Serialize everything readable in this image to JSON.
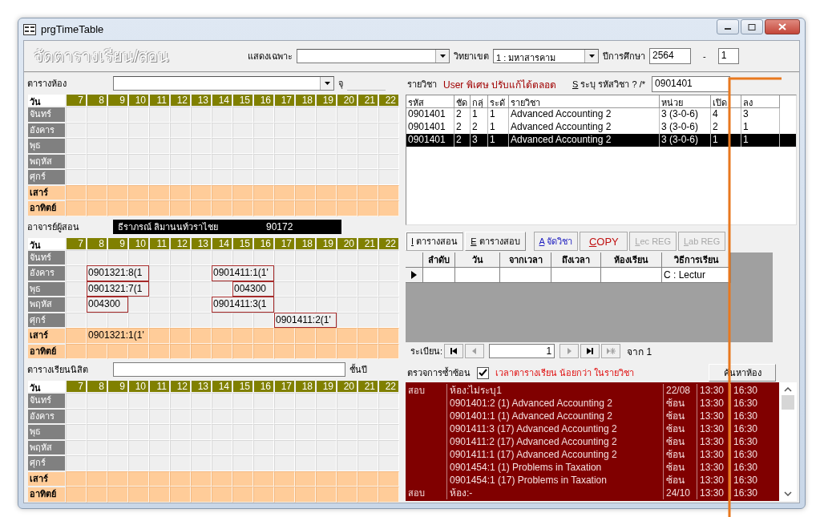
{
  "window": {
    "title": "prgTimeTable"
  },
  "header": {
    "heading": "จัดตารางเรียน/สอน",
    "filter_label": "แสดงเฉพาะ",
    "campus_label": "วิทยาเขต",
    "campus": "1 : มหาสารคาม",
    "year_label": "ปีการศึกษา",
    "year": "2564",
    "dash": "-",
    "term": "1"
  },
  "sections": [
    {
      "kind": "room",
      "label": "ตารางห้อง",
      "seats_label": "จุ",
      "grid": {
        "corner": "วัน",
        "hours": [
          "7",
          "8",
          "9",
          "10",
          "11",
          "12",
          "13",
          "14",
          "15",
          "16",
          "17",
          "18",
          "19",
          "20",
          "21",
          "22"
        ],
        "days": [
          {
            "name": "จันทร์",
            "weekend": false
          },
          {
            "name": "อังคาร",
            "weekend": false
          },
          {
            "name": "พุธ",
            "weekend": false
          },
          {
            "name": "พฤหัส",
            "weekend": false
          },
          {
            "name": "ศุกร์",
            "weekend": false
          },
          {
            "name": "เสาร์",
            "weekend": true
          },
          {
            "name": "อาทิตย์",
            "weekend": true
          }
        ]
      }
    },
    {
      "kind": "teacher",
      "label": "อาจารย์ผู้สอน",
      "name": "ธีราภรณ์ ลิมานนท์วราไชย",
      "id": "90172",
      "grid": {
        "corner": "วัน",
        "hours": [
          "7",
          "8",
          "9",
          "10",
          "11",
          "12",
          "13",
          "14",
          "15",
          "16",
          "17",
          "18",
          "19",
          "20",
          "21",
          "22"
        ],
        "days": [
          {
            "name": "จันทร์",
            "weekend": false
          },
          {
            "name": "อังคาร",
            "weekend": false,
            "slots": [
              {
                "kind": "free"
              },
              {
                "kind": "class",
                "text": "0901321:8(1"
              },
              {
                "kind": "more"
              },
              {
                "kind": "more"
              },
              {
                "kind": "free"
              },
              {
                "kind": "free"
              },
              {
                "kind": "free"
              },
              {
                "kind": "class",
                "text": "0901411:1(1'"
              },
              {
                "kind": "more"
              },
              {
                "kind": "more"
              },
              {
                "kind": "free"
              },
              {
                "kind": "free"
              },
              {
                "kind": "free"
              },
              {
                "kind": "free"
              },
              {
                "kind": "free"
              },
              {
                "kind": "free"
              }
            ]
          },
          {
            "name": "พุธ",
            "weekend": false,
            "slots": [
              {
                "kind": "free"
              },
              {
                "kind": "class",
                "text": "0901321:7(1"
              },
              {
                "kind": "more"
              },
              {
                "kind": "more"
              },
              {
                "kind": "free"
              },
              {
                "kind": "free"
              },
              {
                "kind": "free"
              },
              {
                "kind": "free"
              },
              {
                "kind": "class",
                "text": "004300"
              },
              {
                "kind": "more"
              },
              {
                "kind": "free"
              },
              {
                "kind": "free"
              },
              {
                "kind": "free"
              },
              {
                "kind": "free"
              },
              {
                "kind": "free"
              },
              {
                "kind": "free"
              }
            ]
          },
          {
            "name": "พฤหัส",
            "weekend": false,
            "slots": [
              {
                "kind": "free"
              },
              {
                "kind": "class",
                "text": "004300"
              },
              {
                "kind": "more"
              },
              {
                "kind": "free"
              },
              {
                "kind": "free"
              },
              {
                "kind": "free"
              },
              {
                "kind": "free"
              },
              {
                "kind": "class",
                "text": "0901411:3(1"
              },
              {
                "kind": "more"
              },
              {
                "kind": "more"
              },
              {
                "kind": "free"
              },
              {
                "kind": "free"
              },
              {
                "kind": "free"
              },
              {
                "kind": "free"
              },
              {
                "kind": "free"
              },
              {
                "kind": "free"
              }
            ]
          },
          {
            "name": "ศุกร์",
            "weekend": false,
            "slots": [
              {
                "kind": "free"
              },
              {
                "kind": "free"
              },
              {
                "kind": "free"
              },
              {
                "kind": "free"
              },
              {
                "kind": "free"
              },
              {
                "kind": "free"
              },
              {
                "kind": "free"
              },
              {
                "kind": "free"
              },
              {
                "kind": "free"
              },
              {
                "kind": "free"
              },
              {
                "kind": "class",
                "text": "0901411:2(1'"
              },
              {
                "kind": "more"
              },
              {
                "kind": "more"
              },
              {
                "kind": "free"
              },
              {
                "kind": "free"
              },
              {
                "kind": "free"
              }
            ]
          },
          {
            "name": "เสาร์",
            "weekend": true,
            "slots": [
              {
                "kind": "free"
              },
              {
                "kind": "class",
                "text": "0901321:1(1'"
              },
              {
                "kind": "more"
              },
              {
                "kind": "more"
              },
              {
                "kind": "free"
              },
              {
                "kind": "free"
              },
              {
                "kind": "free"
              },
              {
                "kind": "free"
              },
              {
                "kind": "free"
              },
              {
                "kind": "free"
              },
              {
                "kind": "free"
              },
              {
                "kind": "free"
              },
              {
                "kind": "free"
              },
              {
                "kind": "free"
              },
              {
                "kind": "free"
              },
              {
                "kind": "free"
              }
            ]
          },
          {
            "name": "อาทิตย์",
            "weekend": true
          }
        ]
      }
    },
    {
      "kind": "student",
      "label": "ตารางเรียนนิสิต",
      "year_label": "ชั้นปี",
      "grid": {
        "corner": "วัน",
        "hours": [
          "7",
          "8",
          "9",
          "10",
          "11",
          "12",
          "13",
          "14",
          "15",
          "16",
          "17",
          "18",
          "19",
          "20",
          "21",
          "22"
        ],
        "days": [
          {
            "name": "จันทร์",
            "weekend": false
          },
          {
            "name": "อังคาร",
            "weekend": false
          },
          {
            "name": "พุธ",
            "weekend": false
          },
          {
            "name": "พฤหัส",
            "weekend": false
          },
          {
            "name": "ศุกร์",
            "weekend": false
          },
          {
            "name": "เสาร์",
            "weekend": true
          },
          {
            "name": "อาทิตย์",
            "weekend": true
          }
        ]
      }
    }
  ],
  "course": {
    "label": "รายวิชา",
    "notice": "User พิเศษ ปรับแก้ได้ตลอด",
    "search_label": "S ระบุ รหัสวิชา ? /*",
    "search_value": "0901401",
    "columns": [
      "รหัส",
      "ชัด",
      "กลุ่",
      "ระดั",
      "รายวิชา",
      "หน่วย",
      "เปิด",
      "ลง"
    ],
    "rows": [
      {
        "cells": [
          "0901401",
          "2",
          "1",
          "1",
          "Advanced Accounting 2",
          "3 (3-0-6)",
          "4",
          "3"
        ],
        "selected": false
      },
      {
        "cells": [
          "0901401",
          "2",
          "2",
          "1",
          "Advanced Accounting 2",
          "3 (3-0-6)",
          "2",
          "1"
        ],
        "selected": false
      },
      {
        "cells": [
          "0901401",
          "2",
          "3",
          "1",
          "Advanced Accounting 2",
          "3 (3-0-6)",
          "1",
          "1"
        ],
        "selected": true
      }
    ]
  },
  "tabs": [
    {
      "label": "I ตารางสอน",
      "selected": true
    },
    {
      "label": "E ตารางสอบ",
      "selected": false
    }
  ],
  "buttons": [
    {
      "label": "A จัดวิชา",
      "kind": "link",
      "disabled": false
    },
    {
      "label": "COPY",
      "kind": "alert",
      "disabled": false
    },
    {
      "label": "Lec REG",
      "kind": "plain",
      "disabled": true
    },
    {
      "label": "Lab REG",
      "kind": "plain",
      "disabled": true
    }
  ],
  "sessions": {
    "columns": [
      "ลำดับ",
      "วัน",
      "จากเวลา",
      "ถึงเวลา",
      "ห้องเรียน",
      "วิธีการเรียน"
    ],
    "rows": [
      {
        "current": true,
        "method": "C : Lectur"
      }
    ]
  },
  "nav": {
    "label": "ระเบียน:",
    "record": "1",
    "of": "จาก 1",
    "buttons": [
      {
        "kind": "first",
        "disabled": false
      },
      {
        "kind": "prev",
        "disabled": true
      },
      {
        "kind": "next",
        "disabled": true
      },
      {
        "kind": "last",
        "disabled": false
      },
      {
        "kind": "new",
        "disabled": true
      }
    ]
  },
  "conflicts": {
    "label": "ตรวจการซ้ำซ้อน",
    "checked": true,
    "warning": "เวลาตารางเรียน น้อยกว่า ในรายวิชา",
    "button": "ค้นหาห้อง",
    "rows": [
      {
        "type": "สอบ",
        "detail": "ห้อง:ไม่ระบุ1",
        "date": "22/08",
        "start": "13:30",
        "end": "16:30"
      },
      {
        "detail": "0901401:2 (1) Advanced Accounting 2",
        "date": "ซ้อน",
        "start": "13:30",
        "end": "16:30"
      },
      {
        "detail": "0901401:1 (1) Advanced Accounting 2",
        "date": "ซ้อน",
        "start": "13:30",
        "end": "16:30"
      },
      {
        "detail": "0901411:3 (17) Advanced Accounting 2",
        "date": "ซ้อน",
        "start": "13:30",
        "end": "16:30"
      },
      {
        "detail": "0901411:2 (17) Advanced Accounting 2",
        "date": "ซ้อน",
        "start": "13:30",
        "end": "16:30"
      },
      {
        "detail": "0901411:1 (17) Advanced Accounting 2",
        "date": "ซ้อน",
        "start": "13:30",
        "end": "16:30"
      },
      {
        "detail": "0901454:1 (1) Problems in Taxation",
        "date": "ซ้อน",
        "start": "13:30",
        "end": "16:30"
      },
      {
        "detail": "0901454:1 (17) Problems in Taxation",
        "date": "ซ้อน",
        "start": "13:30",
        "end": "16:30"
      },
      {
        "type": "สอบ",
        "detail": "ห้อง:-",
        "date": "24/10",
        "start": "13:30",
        "end": "16:30"
      }
    ]
  }
}
